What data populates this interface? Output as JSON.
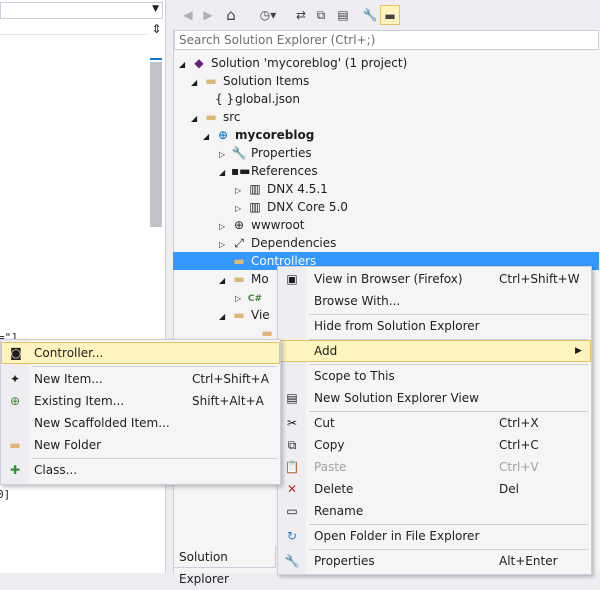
{
  "editor": {
    "code_fragments": [
      "=\"]",
      "0]"
    ]
  },
  "toolbar": {
    "buttons": [
      {
        "name": "back-icon",
        "glyph": "◀",
        "disabled": true
      },
      {
        "name": "forward-icon",
        "glyph": "▶",
        "disabled": true
      },
      {
        "name": "home-icon",
        "glyph": "⌂",
        "disabled": false
      },
      {
        "name": "history-icon",
        "glyph": "◷▾",
        "disabled": false
      },
      {
        "name": "sync-icon",
        "glyph": "⇄",
        "disabled": false
      },
      {
        "name": "collapse-all-icon",
        "glyph": "⧉",
        "disabled": false
      },
      {
        "name": "show-all-files-icon",
        "glyph": "▤",
        "disabled": false
      },
      {
        "name": "properties-wrench-icon",
        "glyph": "🔧",
        "disabled": false
      },
      {
        "name": "preview-selected-icon",
        "glyph": "▬",
        "disabled": false
      }
    ]
  },
  "search": {
    "placeholder": "Search Solution Explorer (Ctrl+;)"
  },
  "tree": [
    {
      "label": "Solution 'mycoreblog' (1 project)",
      "icon": "solution-icon"
    },
    {
      "label": "Solution Items",
      "icon": "folder-icon"
    },
    {
      "label": "global.json",
      "icon": "json-file-icon"
    },
    {
      "label": "src",
      "icon": "folder-icon"
    },
    {
      "label": "mycoreblog",
      "icon": "web-project-icon"
    },
    {
      "label": "Properties",
      "icon": "wrench-icon"
    },
    {
      "label": "References",
      "icon": "references-icon"
    },
    {
      "label": "DNX 4.5.1",
      "icon": "framework-icon"
    },
    {
      "label": "DNX Core 5.0",
      "icon": "framework-icon"
    },
    {
      "label": "wwwroot",
      "icon": "globe-icon"
    },
    {
      "label": "Dependencies",
      "icon": "dependencies-icon"
    },
    {
      "label": "Controllers",
      "icon": "folder-icon"
    },
    {
      "label": "Mo",
      "icon": "folder-icon"
    },
    {
      "label": "C#",
      "icon": "csharp-file-icon"
    },
    {
      "label": "Vie",
      "icon": "folder-icon"
    }
  ],
  "bottom_tab": {
    "label": "Solution Explorer"
  },
  "context_menu": {
    "items": [
      {
        "label": "View in Browser (Firefox)",
        "shortcut": "Ctrl+Shift+W",
        "icon": "view-in-browser-icon"
      },
      {
        "label": "Browse With...",
        "shortcut": "",
        "icon": ""
      },
      {
        "label": "Hide from Solution Explorer",
        "shortcut": "",
        "icon": ""
      },
      {
        "label": "Add",
        "shortcut": "",
        "icon": "",
        "arrow": "▶"
      },
      {
        "label": "Scope to This",
        "shortcut": "",
        "icon": ""
      },
      {
        "label": "New Solution Explorer View",
        "shortcut": "",
        "icon": "new-view-icon"
      },
      {
        "label": "Cut",
        "shortcut": "Ctrl+X",
        "icon": "cut-icon"
      },
      {
        "label": "Copy",
        "shortcut": "Ctrl+C",
        "icon": "copy-icon"
      },
      {
        "label": "Paste",
        "shortcut": "Ctrl+V",
        "icon": "paste-icon"
      },
      {
        "label": "Delete",
        "shortcut": "Del",
        "icon": "delete-icon"
      },
      {
        "label": "Rename",
        "shortcut": "",
        "icon": "rename-icon"
      },
      {
        "label": "Open Folder in File Explorer",
        "shortcut": "",
        "icon": "open-folder-icon"
      },
      {
        "label": "Properties",
        "shortcut": "Alt+Enter",
        "icon": "properties-icon"
      }
    ]
  },
  "add_submenu": {
    "items": [
      {
        "label": "Controller...",
        "shortcut": "",
        "icon": "controller-icon"
      },
      {
        "label": "New Item...",
        "shortcut": "Ctrl+Shift+A",
        "icon": "new-item-icon"
      },
      {
        "label": "Existing Item...",
        "shortcut": "Shift+Alt+A",
        "icon": "existing-item-icon"
      },
      {
        "label": "New Scaffolded Item...",
        "shortcut": "",
        "icon": ""
      },
      {
        "label": "New Folder",
        "shortcut": "",
        "icon": "new-folder-icon"
      },
      {
        "label": "Class...",
        "shortcut": "",
        "icon": "class-icon"
      }
    ]
  }
}
